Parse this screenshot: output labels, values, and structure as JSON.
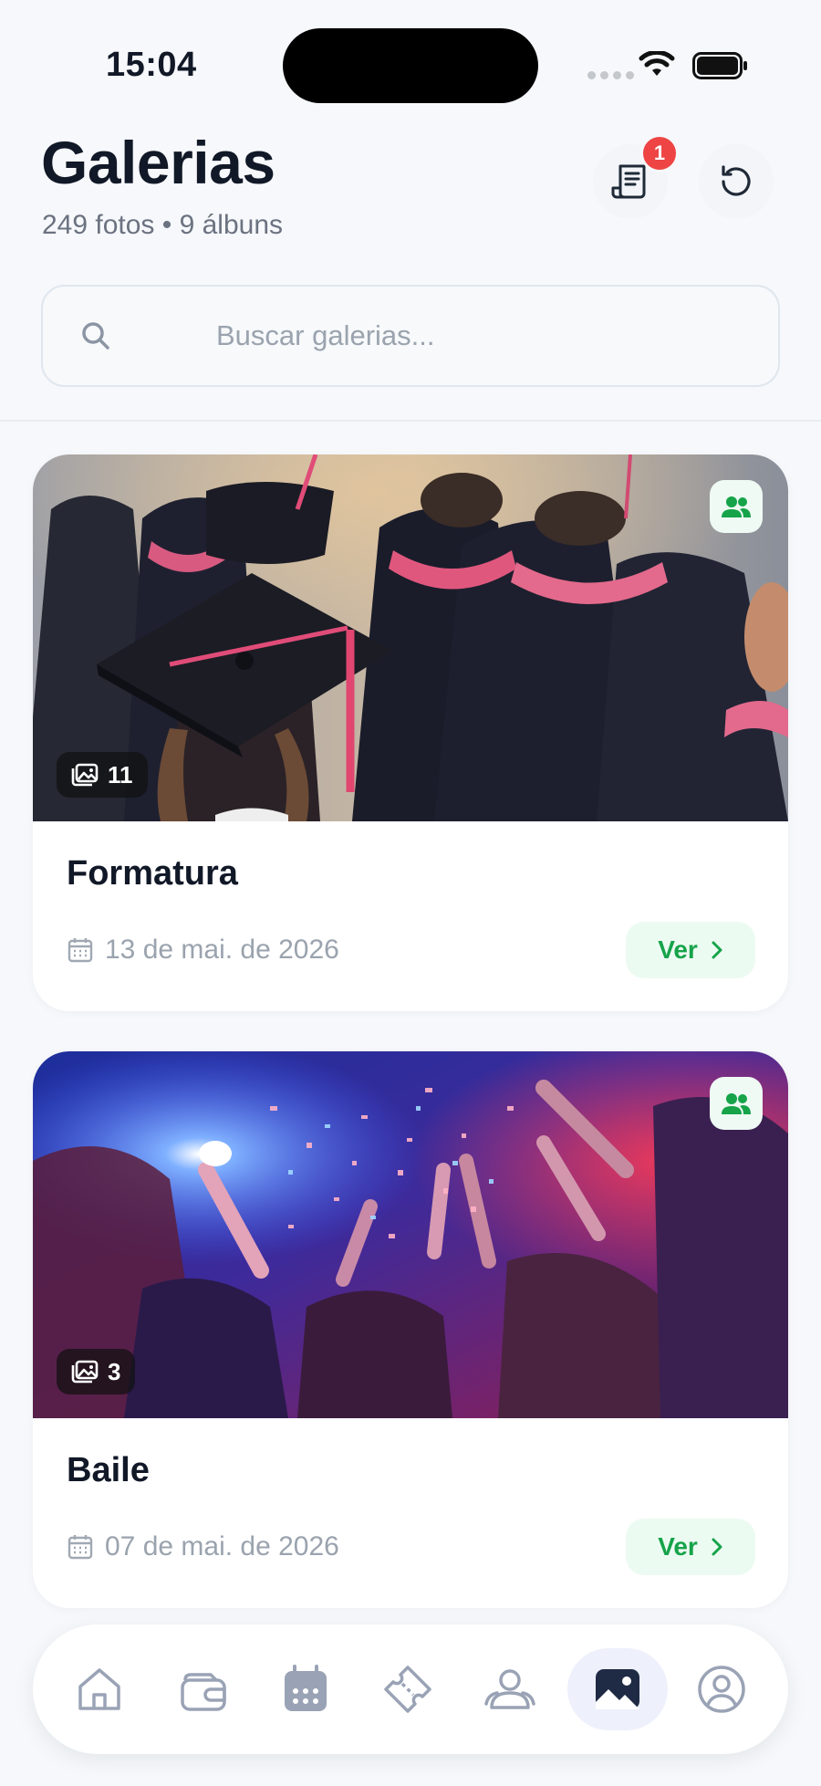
{
  "status_bar": {
    "time": "15:04"
  },
  "header": {
    "title": "Galerias",
    "subtitle": "249 fotos • 9 álbuns",
    "notification_count": "1"
  },
  "search": {
    "placeholder": "Buscar galerias..."
  },
  "galleries": [
    {
      "title": "Formatura",
      "date": "13 de mai. de 2026",
      "photo_count": "11",
      "action": "Ver"
    },
    {
      "title": "Baile",
      "date": "07 de mai. de 2026",
      "photo_count": "3",
      "action": "Ver"
    }
  ],
  "tab_bar": {
    "items": [
      "home-icon",
      "wallet-icon",
      "calendar-icon",
      "ticket-icon",
      "users-icon",
      "gallery-icon",
      "profile-icon"
    ],
    "active": "gallery-icon"
  },
  "colors": {
    "accent_green": "#16a34a",
    "badge_red": "#ef4444",
    "tab_active_bg": "#eef0fb",
    "icon_gray": "#9aa3b5"
  }
}
